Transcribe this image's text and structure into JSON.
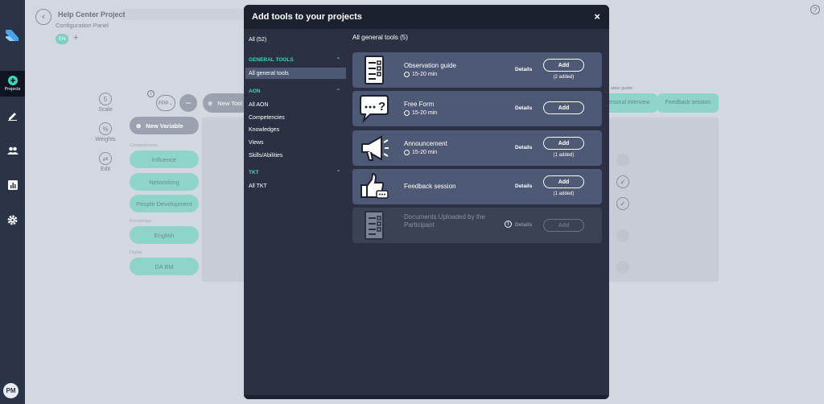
{
  "nav": {
    "projects_label": "Projects",
    "avatar_initials": "PM"
  },
  "background": {
    "project_title": "Help Center Project",
    "project_subtitle": "Configuration Panel",
    "language": "EN",
    "fpp_label": "FPP",
    "new_tool_label": "New Tool",
    "new_variable_label": "New Variable",
    "side_tools": [
      "Scale",
      "Weights",
      "Edit"
    ],
    "groups": [
      "Competencies",
      "Knowledge",
      "Digital"
    ],
    "variables": [
      "Influence",
      "Networking",
      "People Development",
      "English",
      "DA BM"
    ],
    "guide_label": "ation guide",
    "tool_columns": [
      "Personal interview",
      "Feedback session"
    ]
  },
  "modal": {
    "title": "Add tools to your projects",
    "close_label": "×",
    "categories": {
      "all": "All (52)",
      "general_header": "GENERAL TOOLS",
      "general_items": [
        "All general tools"
      ],
      "aon_header": "AON",
      "aon_items": [
        "All AON",
        "Competencies",
        "Knowledges",
        "Views",
        "Skills/Abilities"
      ],
      "tkt_header": "TKT",
      "tkt_items": [
        "All TKT"
      ]
    },
    "content_title": "All general tools (5)",
    "details_label": "Details",
    "add_label": "Add",
    "tools": [
      {
        "name": "Observation guide",
        "duration": "15-20 min",
        "added": "(2 added)"
      },
      {
        "name": "Free Form",
        "duration": "15-20 min",
        "added": ""
      },
      {
        "name": "Announcement",
        "duration": "15-20 min",
        "added": "(1 added)"
      },
      {
        "name": "Feedback session",
        "duration": "",
        "added": "(1 added)"
      },
      {
        "name": "Documents Uploaded by the Participant",
        "duration": "",
        "added": ""
      }
    ]
  },
  "colors": {
    "accent": "#3fd3b9",
    "modal_bg": "#2b3142",
    "card_bg": "#4e5a75"
  }
}
